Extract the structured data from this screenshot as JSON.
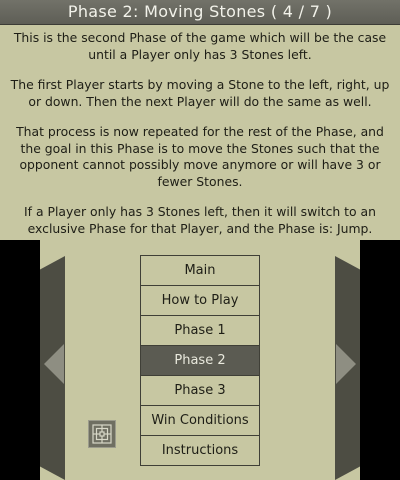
{
  "header": {
    "title": "Phase 2: Moving Stones ( 4 / 7 )"
  },
  "description": {
    "paragraphs": [
      "This is the second Phase of the game which will be the case until a Player only has 3 Stones left.",
      "The first Player starts by moving a Stone to the left, right, up or down. Then the next Player will do the same as well.",
      "That process is now repeated for the rest of the Phase, and the goal in this Phase is to move the Stones such that the opponent cannot possibly move anymore or will have 3 or fewer Stones.",
      "If a Player only has 3 Stones left, then it will switch to an exclusive Phase for that Player, and the Phase is: Jump."
    ]
  },
  "menu": {
    "items": [
      {
        "label": "Main"
      },
      {
        "label": "How to Play"
      },
      {
        "label": "Phase 1"
      },
      {
        "label": "Phase 2"
      },
      {
        "label": "Phase 3"
      },
      {
        "label": "Win Conditions"
      },
      {
        "label": "Instructions"
      }
    ],
    "selected": "Phase 2"
  },
  "icons": {
    "prev": "left-arrow-icon",
    "next": "right-arrow-icon",
    "board": "board-grid-icon"
  },
  "colors": {
    "background": "#c7c7a2",
    "title_bar": "#64645c",
    "selected_item": "#5b5b52",
    "side_bars": "#000000"
  }
}
